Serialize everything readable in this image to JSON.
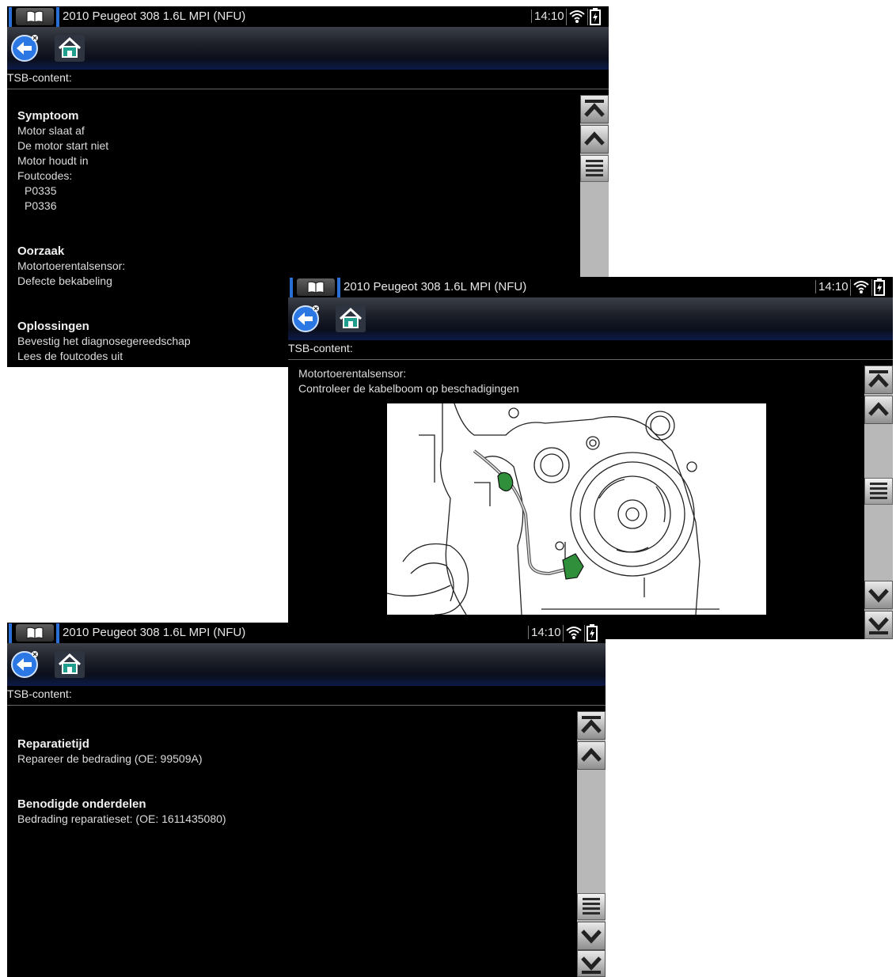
{
  "device": {
    "vehicle_title": "2010 Peugeot 308 1.6L MPI (NFU)",
    "time": "14:10"
  },
  "header_label": "TSB-content:",
  "screen1": {
    "sections": [
      {
        "heading": "Symptoom",
        "lines": [
          "Motor slaat af",
          "De motor start niet",
          "Motor houdt in",
          "Foutcodes:"
        ],
        "sublines": [
          "P0335",
          "P0336"
        ]
      },
      {
        "heading": "Oorzaak",
        "lines": [
          "Motortoerentalsensor:",
          "Defecte bekabeling"
        ]
      },
      {
        "heading": "Oplossingen",
        "lines": [
          "Bevestig het diagnosegereedschap",
          "Lees de foutcodes uit"
        ]
      }
    ]
  },
  "screen2": {
    "lines": [
      "Motortoerentalsensor:",
      "Controleer de kabelboom op beschadigingen"
    ]
  },
  "screen3": {
    "sections": [
      {
        "heading": "Reparatietijd",
        "lines": [
          "Repareer de bedrading (OE: 99509A)"
        ]
      },
      {
        "heading": "Benodigde onderdelen",
        "lines": [
          "Bedrading reparatieset: (OE: 1611435080)"
        ]
      }
    ]
  },
  "icons": {
    "book": "book-icon",
    "back": "back-arrow-icon",
    "home": "home-icon",
    "wifi": "wifi-icon",
    "battery": "battery-icon",
    "scroll_top": "double-chevron-up-icon",
    "scroll_up": "chevron-up-icon",
    "scroll_down": "chevron-down-icon",
    "scroll_bottom": "double-chevron-down-icon"
  },
  "colors": {
    "accent_blue": "#2a6fd6",
    "connector_green": "#2f8f3a"
  }
}
